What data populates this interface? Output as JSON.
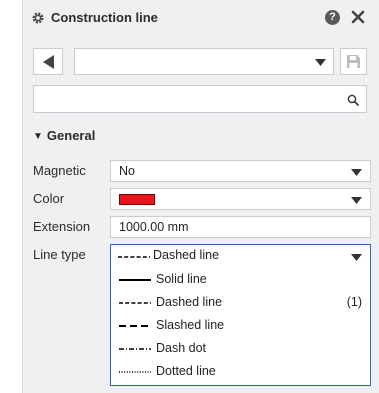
{
  "header": {
    "title": "Construction line",
    "help_glyph": "?"
  },
  "toolbar": {
    "preset_value": ""
  },
  "search": {
    "placeholder": ""
  },
  "section": {
    "title": "General"
  },
  "properties": {
    "magnetic": {
      "label": "Magnetic",
      "value": "No"
    },
    "color": {
      "label": "Color",
      "swatch_hex": "#e8141e"
    },
    "extension": {
      "label": "Extension",
      "value": "1000.00 mm"
    },
    "line_type": {
      "label": "Line type",
      "value": "Dashed line"
    }
  },
  "line_type_options": [
    {
      "label": "Solid line",
      "count": ""
    },
    {
      "label": "Dashed line",
      "count": "(1)"
    },
    {
      "label": "Slashed line",
      "count": ""
    },
    {
      "label": "Dash dot",
      "count": ""
    },
    {
      "label": "Dotted line",
      "count": ""
    }
  ],
  "colors": {
    "accent_border": "#2e68b5",
    "panel_bg": "#eef0f2"
  }
}
